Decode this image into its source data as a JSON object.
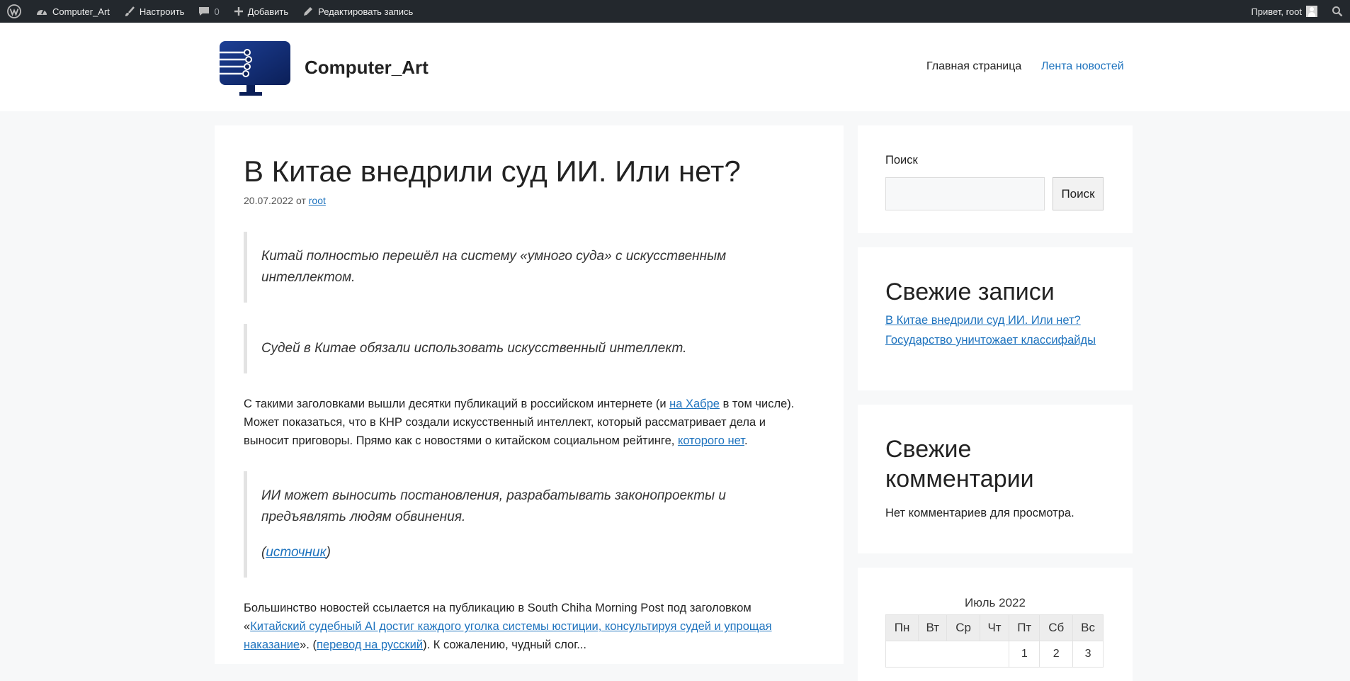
{
  "adminbar": {
    "site_name": "Computer_Art",
    "customize": "Настроить",
    "comments_count": "0",
    "add_new": "Добавить",
    "edit_post": "Редактировать запись",
    "greeting": "Привет, root"
  },
  "header": {
    "site_title": "Computer_Art",
    "nav": [
      {
        "label": "Главная страница"
      },
      {
        "label": "Лента новостей"
      }
    ]
  },
  "article": {
    "title": "В Китае внедрили суд ИИ. Или нет?",
    "date": "20.07.2022",
    "by": "от",
    "author": "root",
    "quote1": "Китай полностью перешёл на систему «умного суда» с искусственным интеллектом.",
    "quote2": "Судей в Китае обязали использовать искусственный интеллект.",
    "para1": {
      "t1": "С такими заголовками вышли десятки публикаций в российском интернете (и ",
      "link1": "на Хабре",
      "t2": " в том числе). Может показаться, что в КНР создали искусственный интеллект, который рассматривает дела и выносит приговоры. Прямо как с новостями о китайском социальном рейтинге, ",
      "link2": "которого нет",
      "t3": "."
    },
    "quote3": "ИИ может выносить постановления, разрабатывать законопроекты и предъявлять людям обвинения.",
    "source_open": "(",
    "source_link": "источник",
    "source_close": ")",
    "para2": {
      "t1": "Большинство новостей ссылается на публикацию в South Chiha Morning Post под заголовком «",
      "link1": "Китайский судебный AI достиг каждого уголка системы юстиции, консультируя судей и упрощая",
      "link1b": "наказание",
      "t2": "». (",
      "link2": "перевод на русский",
      "t3": "). К сожалению, чудный слог..."
    }
  },
  "sidebar": {
    "search_label": "Поиск",
    "search_value": "",
    "search_button": "Поиск",
    "recent_title": "Свежие записи",
    "recent_posts": [
      {
        "label": "В Китае внедрили суд ИИ. Или нет?"
      },
      {
        "label": "Государство уничтожает классифайды"
      }
    ],
    "comments_title": "Свежие комментарии",
    "no_comments": "Нет комментариев для просмотра.",
    "calendar": {
      "caption": "Июль 2022",
      "weekdays": [
        "Пн",
        "Вт",
        "Ср",
        "Чт",
        "Пт",
        "Сб",
        "Вс"
      ],
      "row1": [
        "",
        "",
        "",
        "",
        "1",
        "2",
        "3"
      ]
    }
  },
  "colors": {
    "adminbar_bg": "#23282d",
    "link": "#1e73be",
    "page_bg": "#f7f8f9"
  }
}
